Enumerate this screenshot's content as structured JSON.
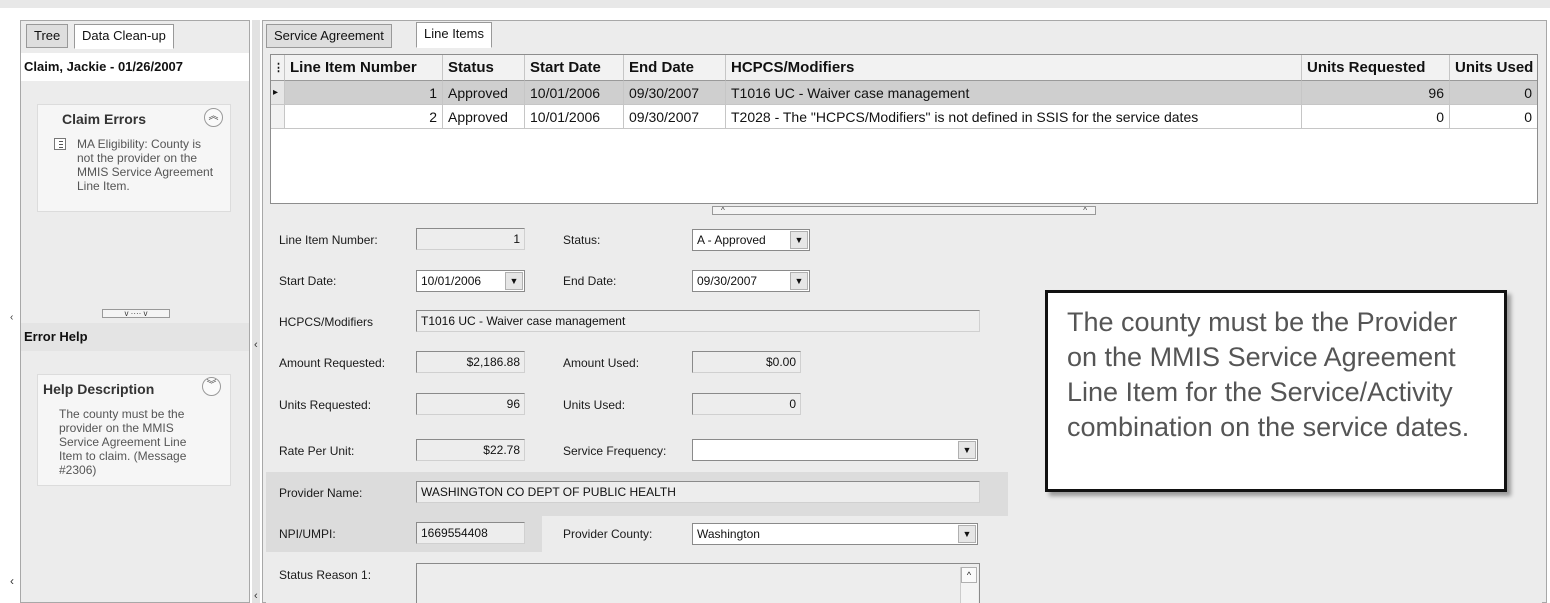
{
  "left_panel": {
    "tabs": [
      {
        "label": "Tree",
        "active": false
      },
      {
        "label": "Data Clean-up",
        "active": true
      }
    ],
    "claim_header": "Claim, Jackie - 01/26/2007",
    "claim_errors": {
      "title": "Claim Errors",
      "items": [
        "MA Eligibility:  County is not the provider on the MMIS Service Agreement Line Item."
      ]
    },
    "error_help": {
      "header": "Error Help",
      "title": "Help Description",
      "text": "The county must be the provider on the MMIS Service Agreement Line Item to claim. (Message #2306)"
    }
  },
  "right_panel": {
    "tabs": [
      {
        "label": "Service Agreement",
        "active": false
      },
      {
        "label": "Line Items",
        "active": true
      }
    ],
    "grid": {
      "columns": [
        "Line Item Number",
        "Status",
        "Start Date",
        "End Date",
        "HCPCS/Modifiers",
        "Units Requested",
        "Units Used"
      ],
      "rows": [
        [
          "1",
          "Approved",
          "10/01/2006",
          "09/30/2007",
          "T1016 UC - Waiver case management",
          "96",
          "0"
        ],
        [
          "2",
          "Approved",
          "10/01/2006",
          "09/30/2007",
          "T2028 - The \"HCPCS/Modifiers\" is not defined in SSIS for the service dates",
          "0",
          "0"
        ]
      ],
      "selected_row": 1
    },
    "form": {
      "line_item_number": {
        "label": "Line Item Number:",
        "value": "1"
      },
      "status": {
        "label": "Status:",
        "value": "A - Approved"
      },
      "start_date": {
        "label": "Start Date:",
        "value": "10/01/2006"
      },
      "end_date": {
        "label": "End Date:",
        "value": "09/30/2007"
      },
      "hcpcs": {
        "label": "HCPCS/Modifiers",
        "value": "T1016 UC - Waiver case management"
      },
      "amount_requested": {
        "label": "Amount Requested:",
        "value": "$2,186.88"
      },
      "amount_used": {
        "label": "Amount Used:",
        "value": "$0.00"
      },
      "units_requested": {
        "label": "Units Requested:",
        "value": "96"
      },
      "units_used": {
        "label": "Units Used:",
        "value": "0"
      },
      "rate_per_unit": {
        "label": "Rate Per Unit:",
        "value": "$22.78"
      },
      "service_frequency": {
        "label": "Service Frequency:",
        "value": ""
      },
      "provider_name": {
        "label": "Provider Name:",
        "value": "WASHINGTON CO DEPT OF PUBLIC HEALTH"
      },
      "npi": {
        "label": "NPI/UMPI:",
        "value": "1669554408"
      },
      "provider_county": {
        "label": "Provider County:",
        "value": "Washington"
      },
      "status_reason_1": {
        "label": "Status Reason 1:",
        "value": ""
      }
    }
  },
  "callout": {
    "text": "The county must be the Provider on the MMIS Service Agreement Line Item for the Service/Activity combination on the service dates."
  },
  "icons": {
    "collapse": "double-chevron-up-icon",
    "expand": "double-chevron-down-icon",
    "dropdown": "triangle-down-icon"
  },
  "colors": {
    "selected_row": "#cfcfcf",
    "panel_bg": "#ececec",
    "callout_border": "#111111"
  }
}
